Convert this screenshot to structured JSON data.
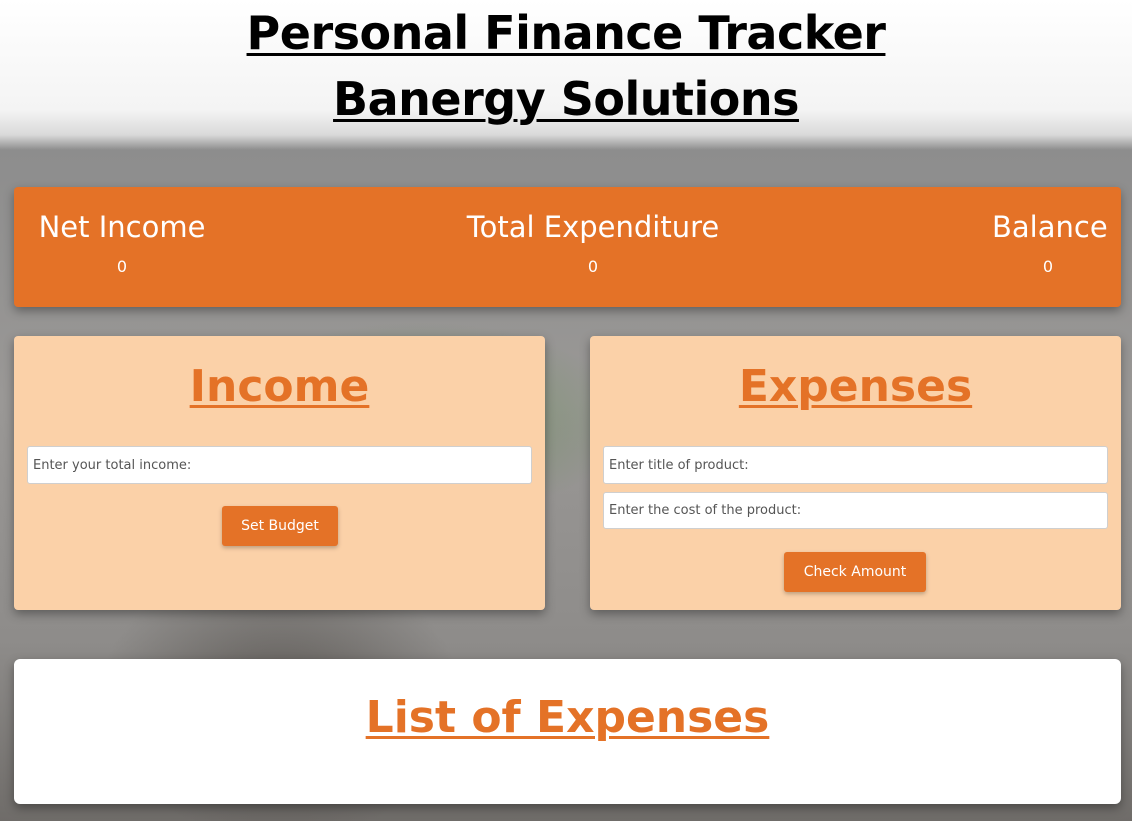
{
  "header": {
    "title": "Personal Finance Tracker",
    "subtitle": "Banergy Solutions"
  },
  "summary": {
    "net_income_label": "Net Income",
    "net_income_value": "0",
    "total_expenditure_label": "Total Expenditure",
    "total_expenditure_value": "0",
    "balance_label": "Balance",
    "balance_value": "0"
  },
  "income": {
    "title": "Income",
    "input_placeholder": "Enter your total income:",
    "input_value": "",
    "button_label": "Set Budget"
  },
  "expenses": {
    "title": "Expenses",
    "title_placeholder": "Enter title of product:",
    "title_value": "",
    "cost_placeholder": "Enter the cost of the product:",
    "cost_value": "",
    "button_label": "Check Amount"
  },
  "list": {
    "title": "List of Expenses",
    "items": []
  },
  "colors": {
    "accent": "#e47227",
    "card_background": "#fbd1a8",
    "list_background": "#ffffff"
  }
}
